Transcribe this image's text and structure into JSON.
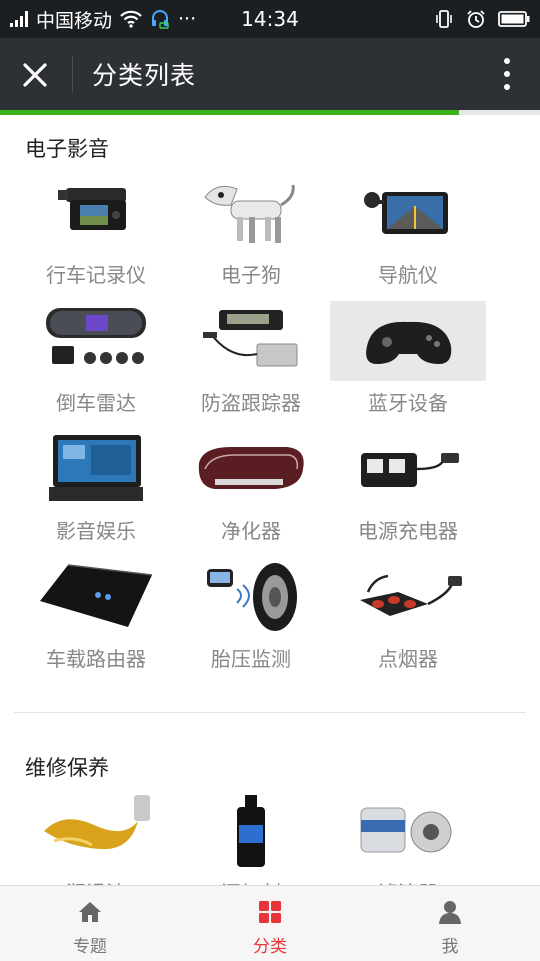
{
  "status_bar": {
    "carrier": "中国移动",
    "ellipsis": "···",
    "time": "14:34"
  },
  "nav": {
    "title": "分类列表",
    "progress": 0.85
  },
  "sections": [
    {
      "title": "电子影音",
      "items": [
        {
          "label": "行车记录仪",
          "icon": "dashcam-icon"
        },
        {
          "label": "电子狗",
          "icon": "robot-dog-icon"
        },
        {
          "label": "导航仪",
          "icon": "gps-navigator-icon"
        },
        {
          "label": "倒车雷达",
          "icon": "parking-sensor-icon"
        },
        {
          "label": "防盗跟踪器",
          "icon": "gps-tracker-icon"
        },
        {
          "label": "蓝牙设备",
          "icon": "bluetooth-device-icon"
        },
        {
          "label": "影音娱乐",
          "icon": "car-stereo-icon"
        },
        {
          "label": "净化器",
          "icon": "air-purifier-icon"
        },
        {
          "label": "电源充电器",
          "icon": "power-inverter-icon"
        },
        {
          "label": "车载路由器",
          "icon": "car-router-icon"
        },
        {
          "label": "胎压监测",
          "icon": "tire-pressure-icon"
        },
        {
          "label": "点烟器",
          "icon": "cigarette-lighter-icon"
        }
      ]
    },
    {
      "title": "维修保养",
      "items": [
        {
          "label": "润滑油",
          "icon": "lubricant-oil-icon"
        },
        {
          "label": "添加剂",
          "icon": "additive-bottle-icon"
        },
        {
          "label": "滤清器",
          "icon": "oil-filter-icon"
        }
      ]
    }
  ],
  "tabs": [
    {
      "label": "专题",
      "icon": "home-icon",
      "active": false
    },
    {
      "label": "分类",
      "icon": "category-grid-icon",
      "active": true
    },
    {
      "label": "我",
      "icon": "user-icon",
      "active": false
    }
  ],
  "colors": {
    "accent_red": "#e8353a",
    "progress_green": "#3bb11a",
    "navbar_bg": "#2d3135",
    "statusbar_bg": "#1c1f22"
  }
}
